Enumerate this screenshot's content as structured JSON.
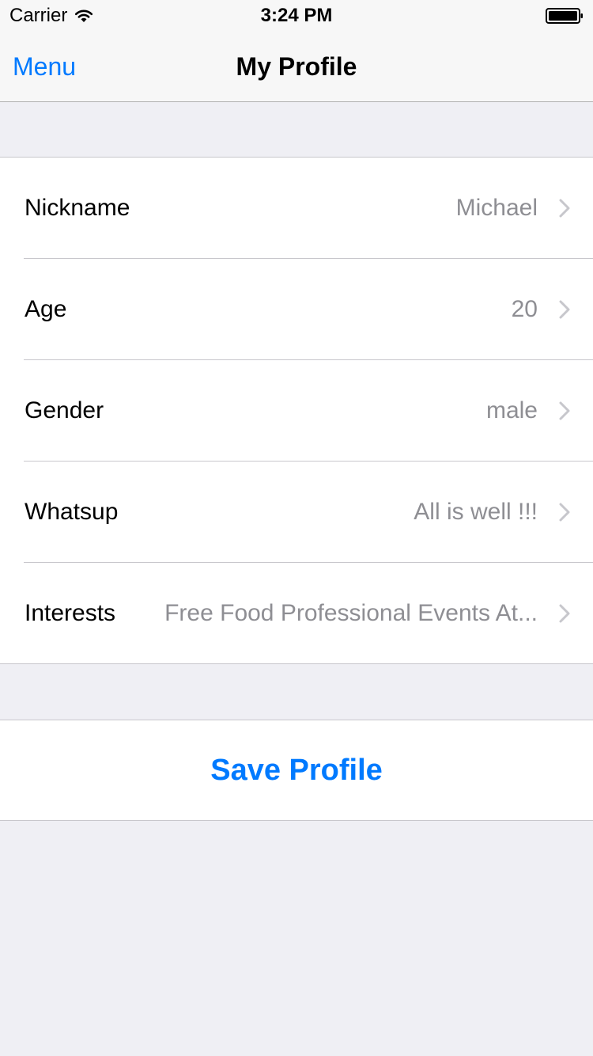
{
  "status_bar": {
    "carrier": "Carrier",
    "time": "3:24 PM",
    "icons": [
      "wifi-icon",
      "battery-icon"
    ]
  },
  "nav": {
    "menu_label": "Menu",
    "title": "My Profile"
  },
  "profile": {
    "rows": [
      {
        "label": "Nickname",
        "value": "Michael"
      },
      {
        "label": "Age",
        "value": "20"
      },
      {
        "label": "Gender",
        "value": "male"
      },
      {
        "label": "Whatsup",
        "value": "All is well !!!"
      },
      {
        "label": "Interests",
        "value": "Free Food Professional Events At..."
      }
    ]
  },
  "actions": {
    "save_label": "Save Profile"
  },
  "colors": {
    "accent": "#007aff",
    "background": "#efeff4",
    "secondary_text": "#8e8e93",
    "separator": "#c8c7cc"
  }
}
